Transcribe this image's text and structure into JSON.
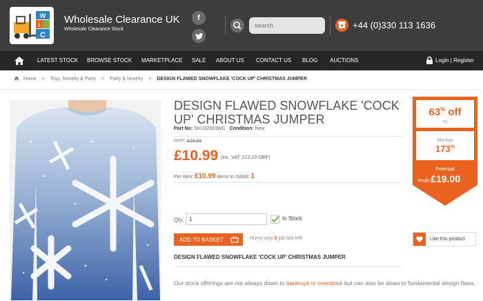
{
  "header": {
    "site_title": "Wholesale Clearance UK",
    "site_subtitle": "Wholesale Clearance Stock",
    "search_placeholder": "search",
    "phone": "+44 (0)330 113 1636",
    "logo_letters": [
      "W",
      "C",
      "i"
    ]
  },
  "nav": {
    "items": [
      "LATEST STOCK",
      "BROWSE STOCK",
      "MARKETPLACE",
      "SALE",
      "ABOUT US",
      "CONTACT US",
      "BLOG",
      "AUCTIONS"
    ],
    "login": "Login | Register"
  },
  "breadcrumb": [
    "Home",
    ">",
    "Toys, Novelty & Party",
    ">",
    "Party & Novelty",
    ">",
    "DESIGN FLAWED SNOWFLAKE 'COCK UP' CHRISTMAS JUMPER"
  ],
  "product": {
    "title": "DESIGN FLAWED SNOWFLAKE 'COCK UP' CHRISTMAS JUMPER",
    "part_no_label": "Part No:",
    "part_no": "SKU32993WC",
    "condition_label": "Condition:",
    "condition": "New",
    "rrp_label": "RRP:",
    "rrp": "£29.99",
    "price": "£10.99",
    "vat_note": "(inc. VAT: £13.19 GBP)",
    "per_item_label": "Per item:",
    "per_item_price": "£10.99",
    "per_item_mid": "Items in Joblot:",
    "items_in_joblot": "1",
    "qty_label": "Qty:",
    "qty_value": "1",
    "stock_status": "In Stock",
    "add_to_basket": "ADD TO BASKET",
    "hurry_pre": "Hurry! only",
    "hurry_count": "0",
    "hurry_post": "job lots left!",
    "like": "Like this product",
    "desc_title": "DESIGN FLAWED SNOWFLAKE 'COCK UP' CHRISTMAS JUMPER",
    "desc_pre": "Our stock offerings are not always down to",
    "desc_link": "bankrupt or overstock",
    "desc_post": "but can also be down to fundamental design flaws."
  },
  "badge": {
    "percent_off": "63",
    "percent_sign": "%",
    "off": "off",
    "rrp": "rrp",
    "markup_label": "Markup",
    "markup_value": "173",
    "markup_sign": "%",
    "potential_label": "Potential",
    "profit_label": "Profit",
    "profit_value": "£19.00"
  },
  "colors": {
    "accent": "#e8631f",
    "header_bg": "#3d3d3d",
    "nav_bg": "#262626"
  },
  "icons": [
    "logo-forklift-icon",
    "facebook-icon",
    "twitter-icon",
    "search-icon",
    "phone-icon",
    "home-icon",
    "lock-icon",
    "check-icon",
    "basket-icon",
    "like-icon"
  ]
}
